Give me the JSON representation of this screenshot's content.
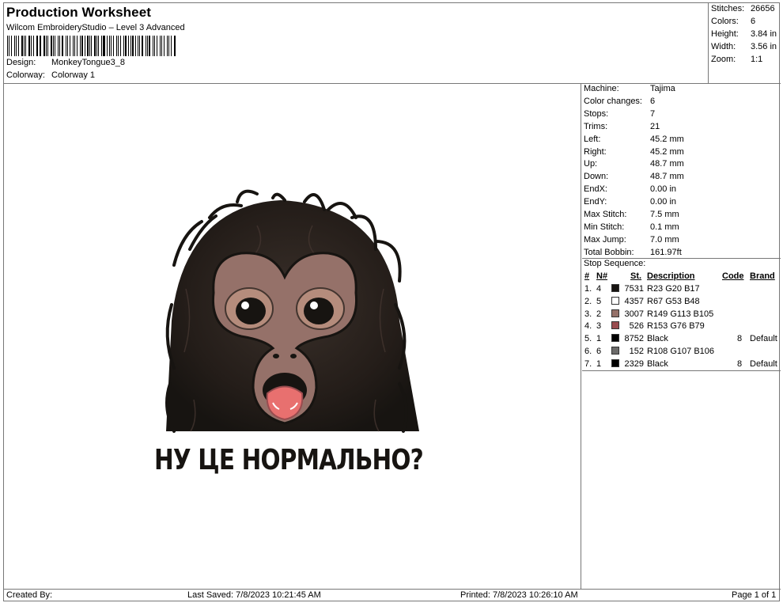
{
  "header": {
    "title": "Production Worksheet",
    "subtitle": "Wilcom EmbroideryStudio – Level 3 Advanced",
    "design_label": "Design:",
    "design_value": "MonkeyTongue3_8",
    "colorway_label": "Colorway:",
    "colorway_value": "Colorway 1"
  },
  "stats": [
    {
      "label": "Stitches:",
      "value": "26656"
    },
    {
      "label": "Colors:",
      "value": "6"
    },
    {
      "label": "Height:",
      "value": "3.84 in"
    },
    {
      "label": "Width:",
      "value": "3.56 in"
    },
    {
      "label": "Zoom:",
      "value": "1:1"
    }
  ],
  "machine_info": [
    {
      "label": "Machine:",
      "value": "Tajima"
    },
    {
      "label": "Color changes:",
      "value": "6"
    },
    {
      "label": "Stops:",
      "value": "7"
    },
    {
      "label": "Trims:",
      "value": "21"
    },
    {
      "label": "Left:",
      "value": "45.2 mm"
    },
    {
      "label": "Right:",
      "value": "45.2 mm"
    },
    {
      "label": "Up:",
      "value": "48.7 mm"
    },
    {
      "label": "Down:",
      "value": "48.7 mm"
    },
    {
      "label": "EndX:",
      "value": "0.00 in"
    },
    {
      "label": "EndY:",
      "value": "0.00 in"
    },
    {
      "label": "Max Stitch:",
      "value": "7.5 mm"
    },
    {
      "label": "Min Stitch:",
      "value": "0.1 mm"
    },
    {
      "label": "Max Jump:",
      "value": "7.0 mm"
    },
    {
      "label": "Total Bobbin:",
      "value": "161.97ft"
    }
  ],
  "stop_sequence": {
    "title": "Stop Sequence:",
    "columns": {
      "num": "#",
      "n": "N#",
      "st": "St.",
      "description": "Description",
      "code": "Code",
      "brand": "Brand"
    },
    "rows": [
      {
        "num": "1.",
        "n": "4",
        "color": "#171411",
        "st": "7531",
        "description": "R23 G20 B17",
        "code": "",
        "brand": ""
      },
      {
        "num": "2.",
        "n": "5",
        "color": "#43353",
        "st": "4357",
        "description": "R67 G53 B48",
        "code": "",
        "brand": ""
      },
      {
        "num": "3.",
        "n": "2",
        "color": "#957169",
        "st": "3007",
        "description": "R149 G113 B105",
        "code": "",
        "brand": ""
      },
      {
        "num": "4.",
        "n": "3",
        "color": "#994C4F",
        "st": "526",
        "description": "R153 G76 B79",
        "code": "",
        "brand": ""
      },
      {
        "num": "5.",
        "n": "1",
        "color": "#000000",
        "st": "8752",
        "description": "Black",
        "code": "8",
        "brand": "Default"
      },
      {
        "num": "6.",
        "n": "6",
        "color": "#6C6B6A",
        "st": "152",
        "description": "R108 G107 B106",
        "code": "",
        "brand": ""
      },
      {
        "num": "7.",
        "n": "1",
        "color": "#000000",
        "st": "2329",
        "description": "Black",
        "code": "8",
        "brand": "Default"
      }
    ]
  },
  "design_caption": "НУ ЦЕ НОРМАЛЬНО?",
  "footer": {
    "created_by": "Created By:",
    "last_saved": "Last Saved: 7/8/2023 10:21:45 AM",
    "printed": "Printed: 7/8/2023 10:26:10 AM",
    "page": "Page 1 of 1"
  }
}
